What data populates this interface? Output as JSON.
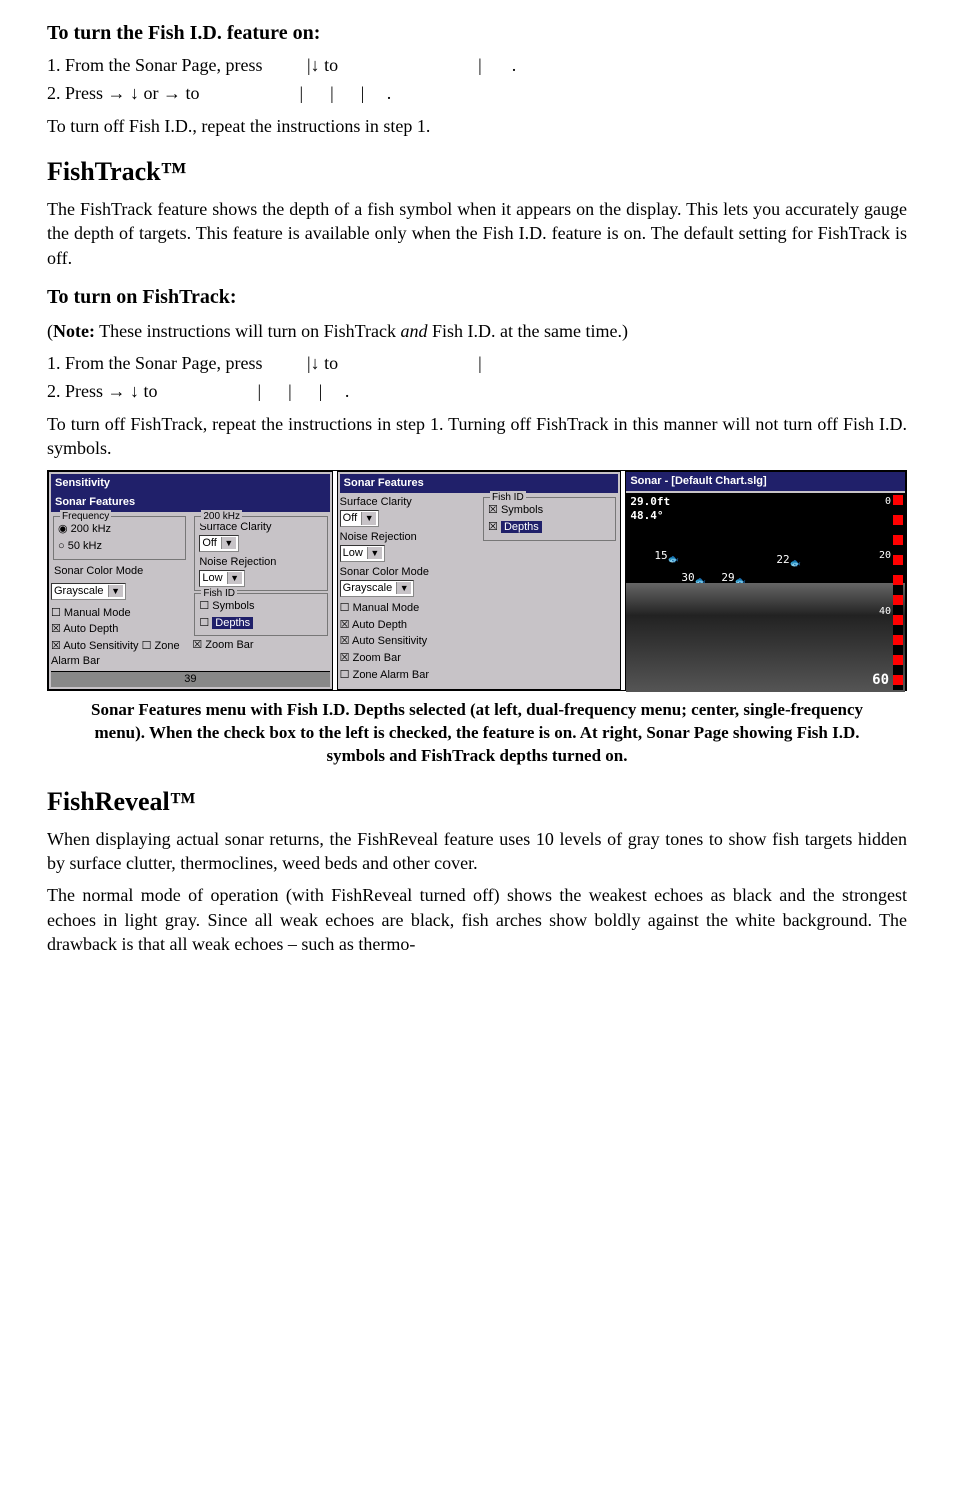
{
  "section_fishid_on": {
    "title": "To turn the Fish I.D. feature on:",
    "step1_a": "1. From the Sonar Page, press ",
    "step1_b": "|↓ to",
    "step1_c": "|",
    "step1_d": ".",
    "step2_a": "2. Press → ↓ or → to",
    "step2_c": "|      |      |     .",
    "off_note": "To turn off Fish I.D., repeat the instructions in step 1."
  },
  "fishtrack": {
    "heading": "FishTrack™",
    "para": "The FishTrack feature shows the depth of a fish symbol when it appears on the display. This lets you accurately gauge the depth of targets. This feature is available only when the Fish I.D. feature is on. The default setting for FishTrack is off.",
    "subheading": "To turn on FishTrack:",
    "note_a": "(",
    "note_b": "Note:",
    "note_c": " These instructions will turn on FishTrack ",
    "note_d": "and",
    "note_e": " Fish I.D. at the same time.)",
    "step1_a": "1. From the Sonar Page, press ",
    "step1_b": "|↓ to",
    "step1_c": "|",
    "step2_a": "2. Press → ↓ to",
    "step2_b": "|      |      |     .",
    "off_para": "To turn off FishTrack, repeat the instructions in step 1. Turning off FishTrack in this manner will not turn off Fish I.D. symbols."
  },
  "screenshot": {
    "panel1": {
      "title": "Sensitivity",
      "title2": "Sonar Features",
      "freq_legend": "Frequency",
      "f200": "200 kHz",
      "f50": "50 kHz",
      "z200_legend": "200 kHz",
      "surf_clarity": "Surface Clarity",
      "off": "Off",
      "noise_rej": "Noise Rejection",
      "low": "Low",
      "sonar_color": "Sonar Color Mode",
      "gray": "Grayscale",
      "fishid_legend": "Fish ID",
      "symbols": "Symbols",
      "depths": "Depths",
      "manual": "Manual Mode",
      "auto_depth": "Auto Depth",
      "zoom_bar": "Zoom Bar",
      "auto_sens": "Auto Sensitivity",
      "zone_alarm": "Zone Alarm Bar",
      "footer_num": "39"
    },
    "panel2": {
      "title": "Sonar Features",
      "surf_clarity": "Surface Clarity",
      "off": "Off",
      "noise_rej": "Noise Rejection",
      "low": "Low",
      "sonar_color": "Sonar Color Mode",
      "gray": "Grayscale",
      "fishid_legend": "Fish ID",
      "symbols": "Symbols",
      "depths": "Depths",
      "manual": "Manual Mode",
      "auto_depth": "Auto Depth",
      "auto_sens": "Auto Sensitivity",
      "zoom_bar": "Zoom Bar",
      "zone_alarm": "Zone Alarm Bar"
    },
    "panel3": {
      "title": "Sonar - [Default Chart.slg]",
      "d1": "29.0ft",
      "d2": "48.4°",
      "f15": "15",
      "f22": "22",
      "f29": "29",
      "f30": "30",
      "r0": "0",
      "r20": "20",
      "r40": "40",
      "num60": "60"
    },
    "caption": "Sonar Features menu with Fish I.D. Depths selected (at left, dual-frequency menu; center, single-frequency menu). When the check box to the left is checked, the feature is on. At right, Sonar Page showing Fish I.D. symbols and FishTrack depths turned on."
  },
  "fishreveal": {
    "heading": "FishReveal™",
    "p1": "When displaying actual sonar returns, the FishReveal feature uses 10 levels of gray tones to show fish targets hidden by surface clutter, thermoclines, weed beds and other cover.",
    "p2": "The normal mode of operation (with FishReveal turned off) shows the weakest echoes as black and the strongest echoes in light gray. Since all weak echoes are black, fish arches show boldly against the white background. The drawback is that all weak echoes – such as thermo-"
  }
}
